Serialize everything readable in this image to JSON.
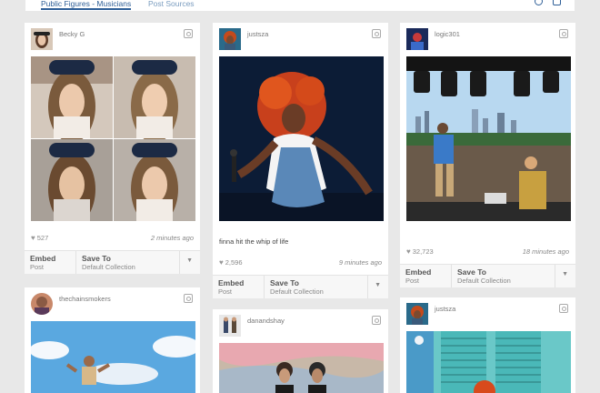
{
  "tabs": [
    "Public Figures - Musicians",
    "Post Sources"
  ],
  "cards": [
    {
      "username": "Becky G",
      "likes": "527",
      "time": "2 minutes ago",
      "caption": "",
      "embed_label": "Embed",
      "embed_sub": "Post",
      "save_label": "Save To",
      "save_sub": "Default Collection"
    },
    {
      "username": "justsza",
      "likes": "2,596",
      "time": "9 minutes ago",
      "caption": "finna hit the whip of life",
      "embed_label": "Embed",
      "embed_sub": "Post",
      "save_label": "Save To",
      "save_sub": "Default Collection"
    },
    {
      "username": "logic301",
      "likes": "32,723",
      "time": "18 minutes ago",
      "caption": "",
      "embed_label": "Embed",
      "embed_sub": "Post",
      "save_label": "Save To",
      "save_sub": "Default Collection"
    },
    {
      "username": "thechainsmokers"
    },
    {
      "username": "danandshay"
    },
    {
      "username": "justsza"
    }
  ],
  "icons": {
    "instagram": "instagram-icon",
    "heart": "heart-icon",
    "caret": "caret-down-icon"
  }
}
